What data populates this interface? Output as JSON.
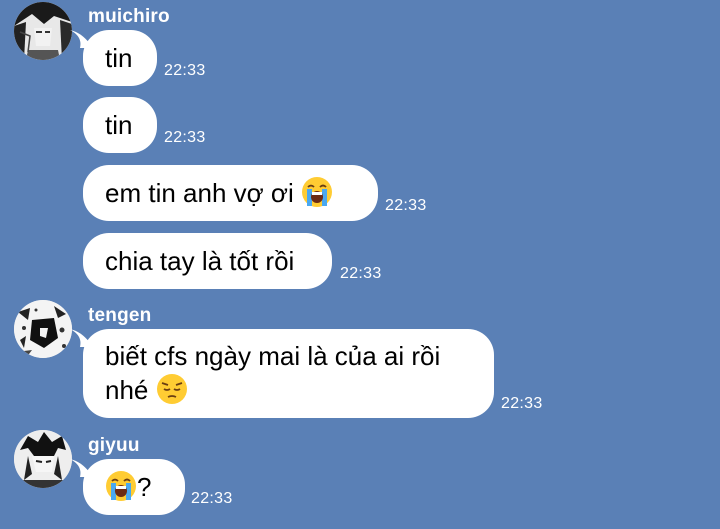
{
  "messages": [
    {
      "sender": "muichiro",
      "avatar_icon": "muichiro-avatar",
      "items": [
        {
          "text": "tin",
          "time": "22:33"
        },
        {
          "text": "tin",
          "time": "22:33"
        },
        {
          "text": "em tin anh vợ ơi",
          "emoji": "loudly-crying-face",
          "time": "22:33"
        },
        {
          "text": "chia tay là tốt rồi",
          "time": "22:33"
        }
      ]
    },
    {
      "sender": "tengen",
      "avatar_icon": "tengen-avatar",
      "items": [
        {
          "line1": "biết cfs ngày mai là của ai rồi",
          "line2": "nhé",
          "emoji": "pensive-face",
          "time": "22:33"
        }
      ]
    },
    {
      "sender": "giyuu",
      "avatar_icon": "giyuu-avatar",
      "items": [
        {
          "emoji": "loudly-crying-face",
          "text": "?",
          "time": "22:33"
        }
      ]
    }
  ]
}
